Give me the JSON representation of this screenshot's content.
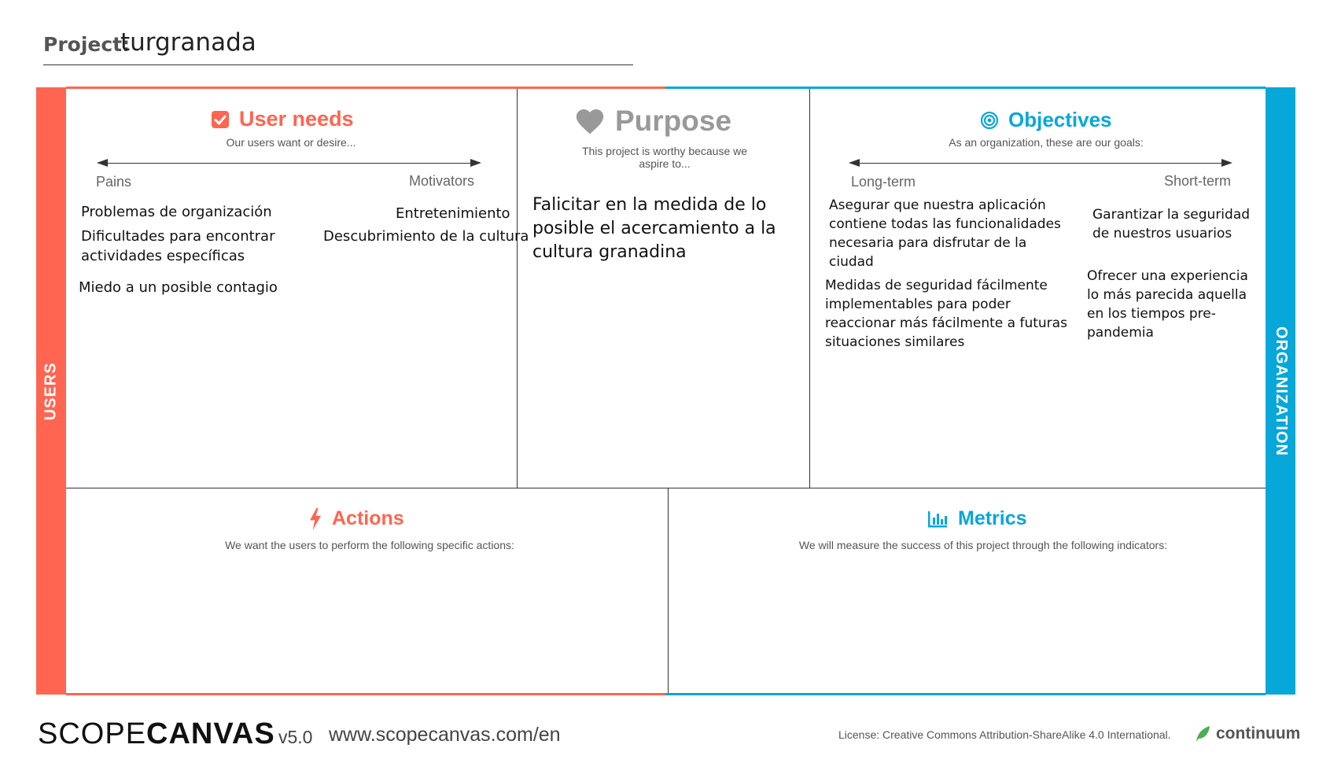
{
  "project": {
    "label": "Project:",
    "value": "turgranada"
  },
  "sidebars": {
    "left": "USERS",
    "right": "ORGANIZATION"
  },
  "colors": {
    "users": "#ff6550",
    "organization": "#07a7d9",
    "purpose": "#999999"
  },
  "user_needs": {
    "icon": "checkbox-icon",
    "title": "User needs",
    "subtitle": "Our users want or desire...",
    "left_scale": "Pains",
    "right_scale": "Motivators",
    "pains": [
      "Problemas de organización",
      "Dificultades para encontrar actividades específicas",
      "Miedo a un posible contagio"
    ],
    "motivators": [
      "Entretenimiento",
      "Descubrimiento de la cultura"
    ]
  },
  "purpose": {
    "icon": "heart-icon",
    "title": "Purpose",
    "subtitle": "This project is worthy because we aspire to...",
    "note": "Falicitar en la medida de lo posible el acercamiento a la cultura granadina"
  },
  "objectives": {
    "icon": "target-icon",
    "title": "Objectives",
    "subtitle": "As an organization, these are our goals:",
    "left_scale": "Long-term",
    "right_scale": "Short-term",
    "long_term": [
      "Asegurar que nuestra aplicación contiene todas las funcionalidades necesaria para disfrutar de la ciudad",
      "Medidas de seguridad fácilmente implementables para poder reaccionar más fácilmente a futuras situaciones similares"
    ],
    "short_term": [
      "Garantizar la seguridad de nuestros usuarios",
      "Ofrecer una experiencia lo más parecida aquella en los tiempos pre-pandemia"
    ]
  },
  "actions": {
    "icon": "lightning-icon",
    "title": "Actions",
    "subtitle": "We want the users to perform the following specific actions:"
  },
  "metrics": {
    "icon": "bar-chart-icon",
    "title": "Metrics",
    "subtitle": "We will measure the success of this project through the following indicators:"
  },
  "footer": {
    "brand_light": "SCOPE",
    "brand_bold": "CANVAS",
    "version": "v5.0",
    "url": "www.scopecanvas.com/en",
    "license": "License: Creative Commons Attribution-ShareAlike 4.0 International.",
    "partner": "continuum"
  }
}
